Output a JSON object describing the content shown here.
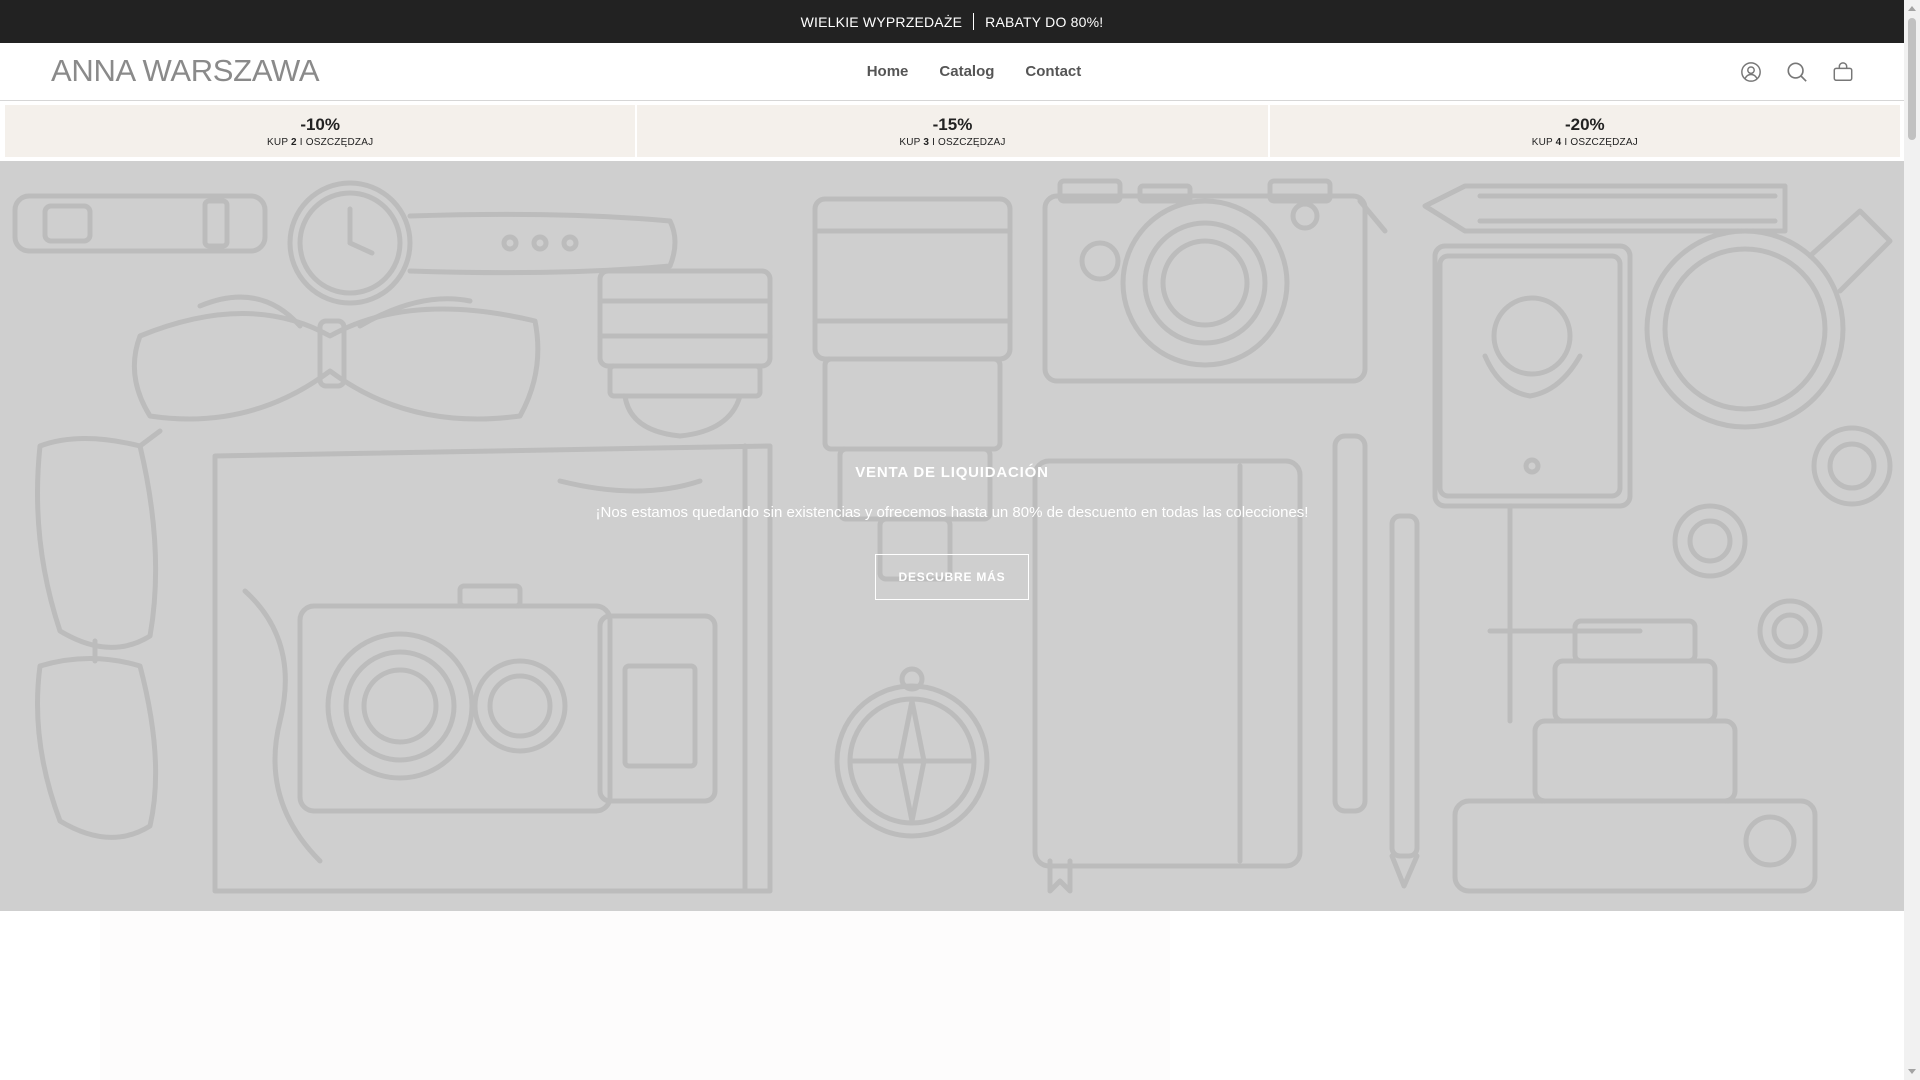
{
  "announcement": {
    "left_text": "WIELKIE WYPRZEDAŻE",
    "right_text": "RABATY DO 80%!"
  },
  "header": {
    "logo": "ANNA WARSZAWA",
    "nav": [
      {
        "label": "Home"
      },
      {
        "label": "Catalog"
      },
      {
        "label": "Contact"
      }
    ],
    "icons": [
      "account-icon",
      "search-icon",
      "cart-icon"
    ]
  },
  "tiers": [
    {
      "pct": "-10%",
      "prefix": "KUP",
      "qty": "2",
      "suffix": "I OSZCZĘDZAJ"
    },
    {
      "pct": "-15%",
      "prefix": "KUP",
      "qty": "3",
      "suffix": "I OSZCZĘDZAJ"
    },
    {
      "pct": "-20%",
      "prefix": "KUP",
      "qty": "4",
      "suffix": "I OSZCZĘDZAJ"
    }
  ],
  "hero": {
    "title": "VENTA DE LIQUIDACIÓN",
    "description": "¡Nos estamos quedando sin existencias y ofrecemos hasta un 80% de descuento en todas las colecciones!",
    "button": "DESCUBRE MÁS"
  },
  "colors": {
    "announcement_bg": "#222222",
    "tier_bg": "#f4f0eb",
    "hero_bg": "#cfcfcf",
    "art_stroke": "#bcbcbc"
  }
}
